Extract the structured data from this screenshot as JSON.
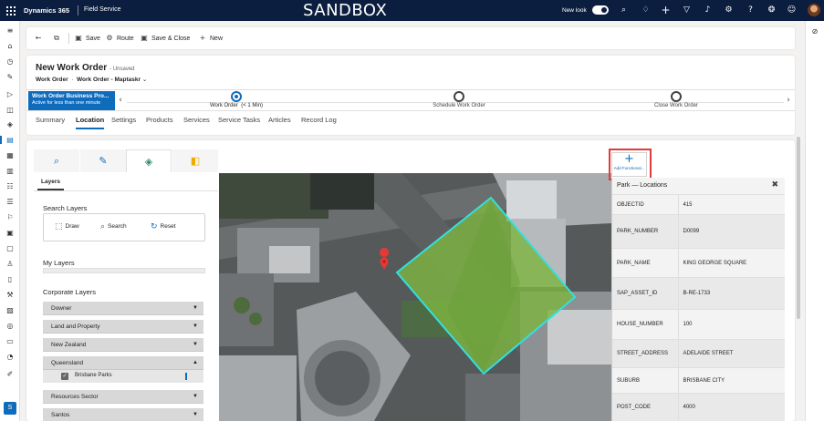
{
  "topbar": {
    "app_name": "Dynamics 365",
    "area_name": "Field Service",
    "environment": "SANDBOX",
    "new_look_label": "New look",
    "new_look_enabled": true,
    "icons": [
      "search-icon",
      "lightbulb-icon",
      "plus-icon",
      "filter-icon",
      "bell-icon",
      "gear-icon",
      "help-icon",
      "copilot-icon",
      "smiley-icon",
      "avatar"
    ]
  },
  "leftrail": {
    "icons": [
      "hamburger-icon",
      "home-icon",
      "recent-icon",
      "pin-icon",
      "play-icon",
      "dashboard-icon",
      "layers-icon",
      "work-orders-icon",
      "calendar-icon",
      "schedule-icon",
      "people-icon",
      "list-icon",
      "map-icon",
      "clipboard-icon",
      "inventory-icon",
      "contact-icon",
      "document-icon",
      "wrench-icon",
      "agreement-icon",
      "globe-icon",
      "truck-icon",
      "gauge-icon",
      "settings-icon"
    ],
    "active_index": 7,
    "area_badge": "S"
  },
  "commandbar": {
    "back_label": "",
    "popout_label": "",
    "save_label": "Save",
    "route_label": "Route",
    "save_close_label": "Save & Close",
    "new_label": "New"
  },
  "header": {
    "title": "New Work Order",
    "status": "- Unsaved",
    "entity": "Work Order",
    "form_name": "Work Order - Maptaskr",
    "form_chevron": "⌄"
  },
  "bpf": {
    "process_name": "Work Order Business Pro...",
    "process_status": "Active for less than one minute",
    "stages": [
      {
        "label": "Work Order",
        "duration": "(< 1 Min)",
        "active": true
      },
      {
        "label": "Schedule Work Order",
        "duration": "",
        "active": false
      },
      {
        "label": "Close Work Order",
        "duration": "",
        "active": false
      }
    ]
  },
  "tabs": [
    {
      "label": "Summary",
      "active": false
    },
    {
      "label": "Location",
      "active": true
    },
    {
      "label": "Settings",
      "active": false
    },
    {
      "label": "Products",
      "active": false
    },
    {
      "label": "Services",
      "active": false
    },
    {
      "label": "Service Tasks",
      "active": false
    },
    {
      "label": "Articles",
      "active": false
    },
    {
      "label": "Record Log",
      "active": false
    }
  ],
  "layers_panel": {
    "tab_icons": [
      "search-icon",
      "edit-icon",
      "layers-icon",
      "esri-icon"
    ],
    "active_tab": 2,
    "heading": "Layers",
    "search_layers_title": "Search Layers",
    "draw_label": "Draw",
    "search_label": "Search",
    "reset_label": "Reset",
    "my_layers_title": "My Layers",
    "corporate_layers_title": "Corporate Layers",
    "groups": [
      {
        "label": "Downer",
        "expanded": false
      },
      {
        "label": "Land and Property",
        "expanded": false
      },
      {
        "label": "New Zealand",
        "expanded": false
      },
      {
        "label": "Queensland",
        "expanded": true
      },
      {
        "label": "Resources Sector",
        "expanded": false
      },
      {
        "label": "Santos",
        "expanded": false
      }
    ],
    "queensland_items": [
      {
        "label": "Brisbane Parks",
        "checked": true
      }
    ]
  },
  "map": {
    "add_functional_label": "Add Functional...",
    "selected_feature_color": "#7cb342",
    "selection_outline_color": "#33e0e0",
    "marker_color": "#e53935"
  },
  "popup": {
    "title": "Park — Locations",
    "close_label": "✖",
    "attributes": [
      {
        "key": "OBJECTID",
        "value": "415"
      },
      {
        "key": "PARK_NUMBER",
        "value": "D0099"
      },
      {
        "key": "PARK_NAME",
        "value": "KING GEORGE SQUARE"
      },
      {
        "key": "SAP_ASSET_ID",
        "value": "B-RE-1733"
      },
      {
        "key": "HOUSE_NUMBER",
        "value": "100"
      },
      {
        "key": "STREET_ADDRESS",
        "value": "ADELAIDE STREET"
      },
      {
        "key": "SUBURB",
        "value": "BRISBANE CITY"
      },
      {
        "key": "POST_CODE",
        "value": "4000"
      }
    ]
  },
  "colors": {
    "topbar_bg": "#0b1e3f",
    "accent": "#0f6cbd",
    "annotation_red": "#e03a3a"
  }
}
